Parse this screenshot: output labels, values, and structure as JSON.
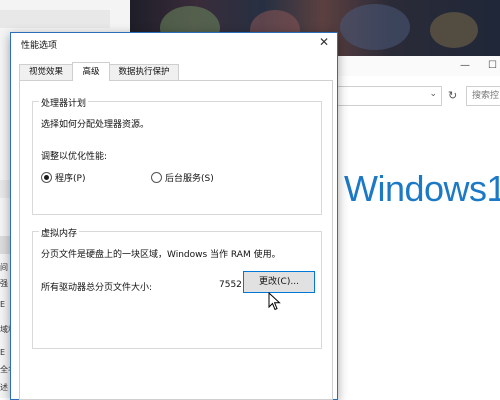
{
  "background": {
    "left_fragments": [
      "间",
      "强",
      "E",
      "域和",
      "E",
      "全名",
      "述"
    ],
    "explorer": {
      "search_placeholder": "搜索控",
      "banner": "Windows1"
    }
  },
  "dialog": {
    "title": "性能选项",
    "close_icon": "close-icon",
    "tabs": [
      {
        "label": "视觉效果",
        "active": false
      },
      {
        "label": "高级",
        "active": true
      },
      {
        "label": "数据执行保护",
        "active": false
      }
    ],
    "processor": {
      "title": "处理器计划",
      "description": "选择如何分配处理器资源。",
      "optimize_label": "调整以优化性能:",
      "options": [
        {
          "label": "程序(P)",
          "checked": true
        },
        {
          "label": "后台服务(S)",
          "checked": false
        }
      ]
    },
    "virtual_memory": {
      "title": "虚拟内存",
      "description": "分页文件是硬盘上的一块区域，Windows 当作 RAM 使用。",
      "total_label": "所有驱动器总分页文件大小:",
      "total_value": "7552 MB",
      "change_button": "更改(C)..."
    }
  }
}
